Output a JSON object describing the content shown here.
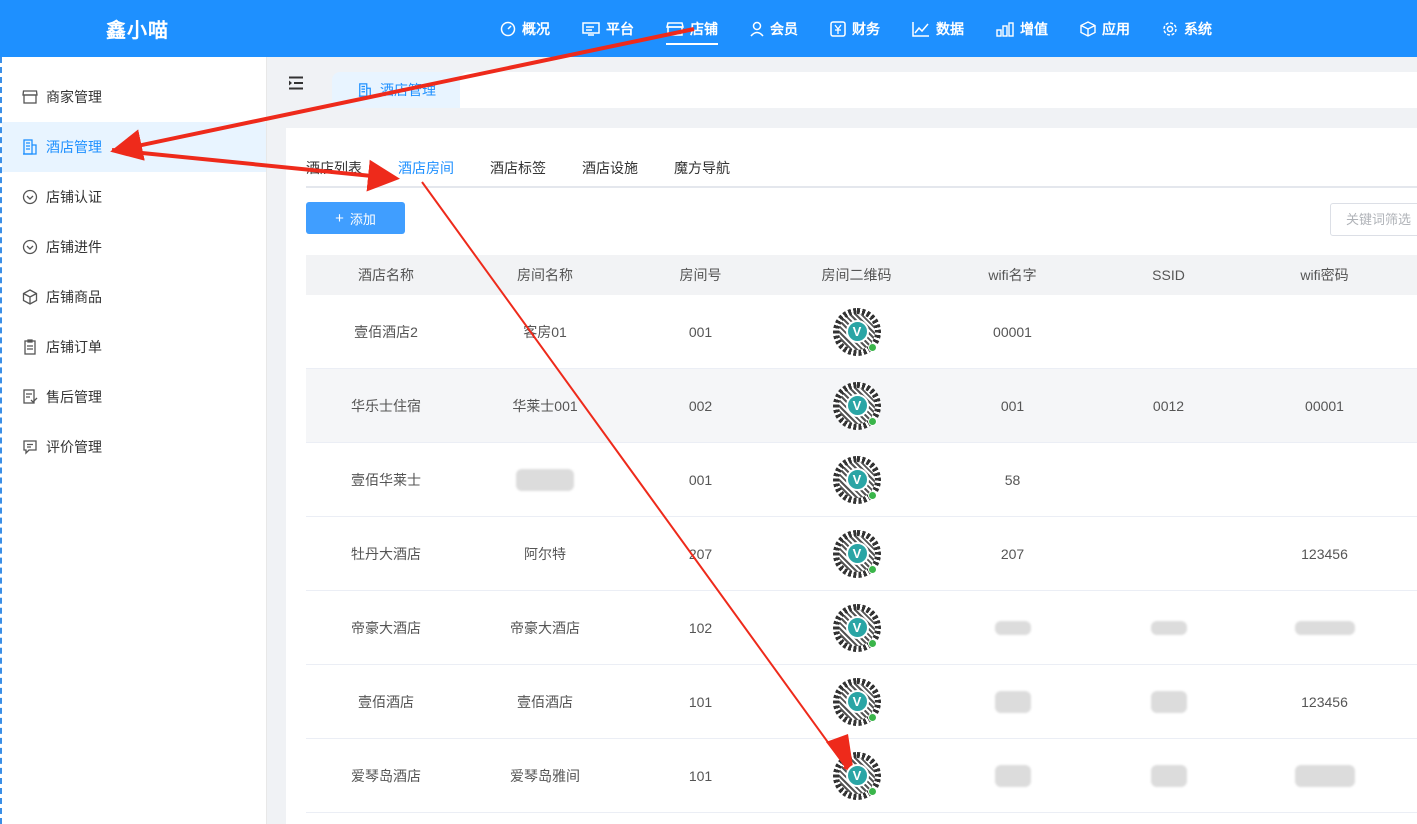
{
  "app": {
    "brand": "鑫小喵"
  },
  "topnav": [
    {
      "label": "概况",
      "icon": "dashboard-icon"
    },
    {
      "label": "平台",
      "icon": "monitor-icon"
    },
    {
      "label": "店铺",
      "icon": "store-icon",
      "active": true
    },
    {
      "label": "会员",
      "icon": "user-icon"
    },
    {
      "label": "财务",
      "icon": "yen-icon"
    },
    {
      "label": "数据",
      "icon": "line-chart-icon"
    },
    {
      "label": "增值",
      "icon": "bar-chart-icon"
    },
    {
      "label": "应用",
      "icon": "cube-icon"
    },
    {
      "label": "系统",
      "icon": "gear-icon"
    }
  ],
  "sidebar": {
    "items": [
      {
        "label": "商家管理",
        "icon": "store-icon"
      },
      {
        "label": "酒店管理",
        "icon": "building-icon",
        "active": true
      },
      {
        "label": "店铺认证",
        "icon": "verified-icon"
      },
      {
        "label": "店铺进件",
        "icon": "verified-icon"
      },
      {
        "label": "店铺商品",
        "icon": "box-icon"
      },
      {
        "label": "店铺订单",
        "icon": "clipboard-icon"
      },
      {
        "label": "售后管理",
        "icon": "service-doc-icon"
      },
      {
        "label": "评价管理",
        "icon": "comment-icon"
      }
    ]
  },
  "pagetab": {
    "label": "酒店管理"
  },
  "subtabs": [
    {
      "label": "酒店列表"
    },
    {
      "label": "酒店房间",
      "active": true
    },
    {
      "label": "酒店标签"
    },
    {
      "label": "酒店设施"
    },
    {
      "label": "魔方导航"
    }
  ],
  "toolbar": {
    "add_label": "添加",
    "add_icon": "plus-icon",
    "filter_label": "关键词筛选"
  },
  "table": {
    "headers": [
      "酒店名称",
      "房间名称",
      "房间号",
      "房间二维码",
      "wifi名字",
      "SSID",
      "wifi密码"
    ],
    "rows": [
      {
        "hotel": "壹佰酒店2",
        "room": "客房01",
        "number": "001",
        "wifi": "00001",
        "ssid": "",
        "password": ""
      },
      {
        "hotel": "华乐士住宿",
        "room": "华莱士001",
        "number": "002",
        "wifi": "001",
        "ssid": "0012",
        "password": "00001"
      },
      {
        "hotel": "壹佰华莱士",
        "room": "",
        "number": "001",
        "wifi": "58",
        "ssid": "",
        "password": ""
      },
      {
        "hotel": "牡丹大酒店",
        "room": "阿尔特",
        "number": "207",
        "wifi": "207",
        "ssid": "",
        "password": "123456"
      },
      {
        "hotel": "帝豪大酒店",
        "room": "帝豪大酒店",
        "number": "102",
        "wifi": "",
        "ssid": "",
        "password": ""
      },
      {
        "hotel": "壹佰酒店",
        "room": "壹佰酒店",
        "number": "101",
        "wifi": "",
        "ssid": "",
        "password": "123456"
      },
      {
        "hotel": "爱琴岛酒店",
        "room": "爱琴岛雅间",
        "number": "101",
        "wifi": "",
        "ssid": "",
        "password": ""
      }
    ],
    "qr_center_glyph": "V"
  },
  "colors": {
    "primary": "#1e90ff",
    "button": "#409eff",
    "annotation_arrow": "#ee2a1b"
  }
}
